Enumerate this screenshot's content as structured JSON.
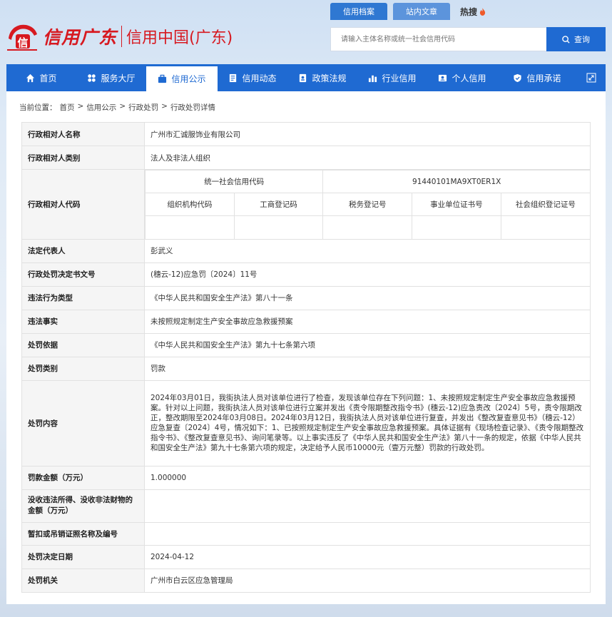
{
  "header": {
    "logo_brand": "信用广东",
    "logo_site": "信用中国(广东)",
    "top_tabs": [
      "信用档案",
      "站内文章"
    ],
    "hot_label": "热搜",
    "search": {
      "placeholder": "请输入主体名称或统一社会信用代码",
      "button": "查询"
    }
  },
  "nav": {
    "items": [
      {
        "label": "首页",
        "icon": "home-icon"
      },
      {
        "label": "服务大厅",
        "icon": "grid-icon"
      },
      {
        "label": "信用公示",
        "icon": "briefcase-icon",
        "active": true
      },
      {
        "label": "信用动态",
        "icon": "document-icon"
      },
      {
        "label": "政策法规",
        "icon": "book-icon"
      },
      {
        "label": "行业信用",
        "icon": "bar-chart-icon"
      },
      {
        "label": "个人信用",
        "icon": "id-card-icon"
      },
      {
        "label": "信用承诺",
        "icon": "shield-icon"
      }
    ]
  },
  "breadcrumb": {
    "prefix": "当前位置：",
    "items": [
      "首页",
      "信用公示",
      "行政处罚",
      "行政处罚详情"
    ],
    "sep": ">"
  },
  "detail": {
    "name_label": "行政相对人名称",
    "name_value": "广州市汇诚服饰业有限公司",
    "category_label": "行政相对人类别",
    "category_value": "法人及非法人组织",
    "code_label": "行政相对人代码",
    "uscc_label": "统一社会信用代码",
    "uscc_value": "91440101MA9XT0ER1X",
    "code_headers": [
      "组织机构代码",
      "工商登记码",
      "税务登记号",
      "事业单位证书号",
      "社会组织登记证号"
    ],
    "code_values": [
      "",
      "",
      "",
      "",
      ""
    ],
    "rep_label": "法定代表人",
    "rep_value": "彭武义",
    "doc_label": "行政处罚决定书文号",
    "doc_value": "(穗云-12)应急罚〔2024〕11号",
    "violation_type_label": "违法行为类型",
    "violation_type_value": "《中华人民共和国安全生产法》第八十一条",
    "facts_label": "违法事实",
    "facts_value": "未按照规定制定生产安全事故应急救援预案",
    "basis_label": "处罚依据",
    "basis_value": "《中华人民共和国安全生产法》第九十七条第六项",
    "penalty_type_label": "处罚类别",
    "penalty_type_value": "罚款",
    "content_label": "处罚内容",
    "content_value": "2024年03月01日，我街执法人员对该单位进行了检查，发现该单位存在下列问题：1、未按照规定制定生产安全事故应急救援预案。针对以上问题，我街执法人员对该单位进行立案并发出《责令限期整改指令书》(穗云-12)应急责改〔2024〕5号，责令限期改正，整改期限至2024年03月08日。2024年03月12日，我街执法人员对该单位进行复查，并发出《整改复查意见书》（穗云-12）应急复查〔2024〕4号，情况如下：1、已按照规定制定生产安全事故应急救援预案。具体证据有《现场检查记录》、《责令限期整改指令书》、《整改复查意见书》、询问笔录等。以上事实违反了《中华人民共和国安全生产法》第八十一条的规定，依据《中华人民共和国安全生产法》第九十七条第六项的规定，决定给予人民币10000元（壹万元整）罚款的行政处罚。",
    "amount_label": "罚款金额（万元）",
    "amount_value": "1.000000",
    "confiscate_label": "没收违法所得、没收非法财物的金额（万元）",
    "confiscate_value": "",
    "revoke_label": "暂扣或吊销证照名称及编号",
    "revoke_value": "",
    "date_label": "处罚决定日期",
    "date_value": "2024-04-12",
    "authority_label": "处罚机关",
    "authority_value": "广州市白云区应急管理局"
  },
  "colors": {
    "brand_red": "#d71920",
    "primary_blue": "#1f6ad2"
  }
}
